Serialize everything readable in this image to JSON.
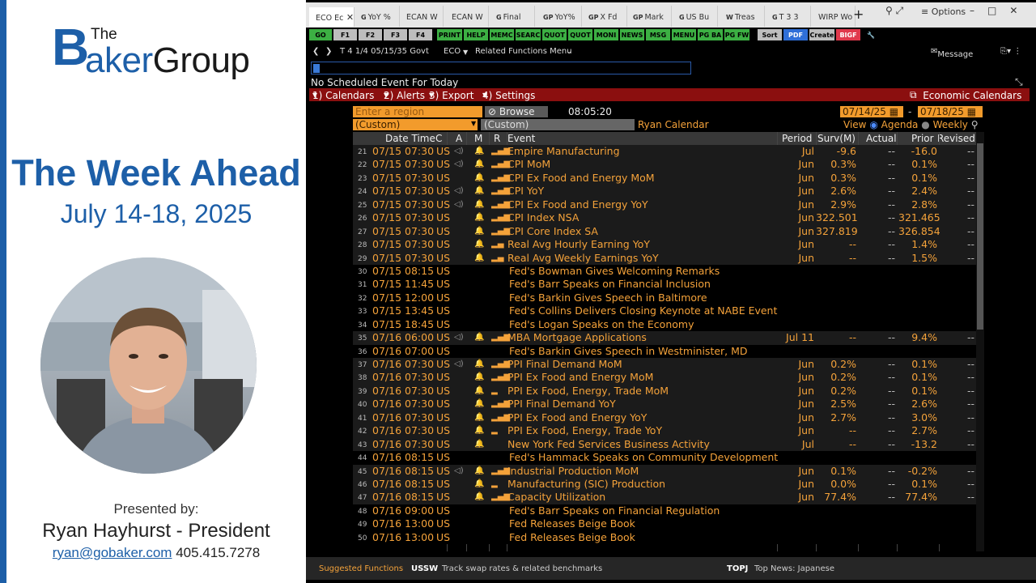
{
  "brand": {
    "the": "The",
    "b": "B",
    "aker": "aker",
    "group": "Group"
  },
  "slide": {
    "title": "The Week Ahead",
    "dates": "July 14-18, 2025",
    "presented_by": "Presented by:",
    "presenter": "Ryan Hayhurst - President",
    "email": "ryan@gobaker.com",
    "phone": "405.415.7278"
  },
  "tabs": [
    "ECO Ec",
    "YoY %",
    "ECAN W",
    "ECAN W",
    "Final",
    "YoY%",
    "X Fd",
    "Mark",
    "US Bu",
    "Treas",
    "T 3 3",
    "WIRP Wo"
  ],
  "tab_prefixes": [
    "",
    "G",
    "",
    "",
    "G",
    "GP",
    "GP",
    "GP",
    "G",
    "W",
    "G",
    ""
  ],
  "options_label": "Options",
  "fkeys": [
    {
      "label": "GO",
      "color": "#3cb043"
    },
    {
      "label": "F1",
      "color": "#bdbdbd"
    },
    {
      "label": "F2",
      "color": "#bdbdbd"
    },
    {
      "label": "F3",
      "color": "#bdbdbd"
    },
    {
      "label": "F4",
      "color": "#bdbdbd"
    },
    {
      "label": "PRINT",
      "color": "#3cb043"
    },
    {
      "label": "HELP",
      "color": "#3cb043"
    },
    {
      "label": "MEMC",
      "color": "#3cb043"
    },
    {
      "label": "SEARC",
      "color": "#3cb043"
    },
    {
      "label": "QUOT",
      "color": "#3cb043"
    },
    {
      "label": "QUOT",
      "color": "#3cb043"
    },
    {
      "label": "MONI",
      "color": "#3cb043"
    },
    {
      "label": "NEWS",
      "color": "#3cb043"
    },
    {
      "label": "MSG",
      "color": "#3cb043"
    },
    {
      "label": "MENU",
      "color": "#3cb043"
    },
    {
      "label": "PG BA",
      "color": "#3cb043"
    },
    {
      "label": "PG FW",
      "color": "#3cb043"
    },
    {
      "label": "Sort",
      "color": "#bdbdbd"
    },
    {
      "label": "PDF",
      "color": "#2f6fd8"
    },
    {
      "label": "Create",
      "color": "#bdbdbd"
    },
    {
      "label": "BIGF",
      "color": "#e0394c"
    }
  ],
  "cmdline": {
    "security": "T 4 1/4 05/15/35 Govt",
    "func": "ECO",
    "related": "Related Functions Menu",
    "message": "Message"
  },
  "no_event": "No Scheduled Event For Today",
  "menu": {
    "calendars": "1) Calendars",
    "alerts": "2) Alerts",
    "export": "3) Export",
    "settings": "4) Settings",
    "econ": "Economic Calendars"
  },
  "controls": {
    "region_placeholder": "Enter a region",
    "browse": "Browse",
    "time": "08:05:20",
    "start_date": "07/14/25",
    "end_date": "07/18/25",
    "custom1": "(Custom)",
    "custom2": "(Custom)",
    "calendar_name": "Ryan Calendar",
    "view": "View",
    "agenda": "Agenda",
    "weekly": "Weekly"
  },
  "headers": {
    "datetime": "Date Time",
    "c": "C",
    "a": "A",
    "m": "M",
    "r": "R",
    "event": "Event",
    "period": "Period",
    "surv": "Surv(M)",
    "actual": "Actual",
    "prior": "Prior",
    "revised": "Revised"
  },
  "rows": [
    {
      "n": "21",
      "dt": "07/15 07:30",
      "c": "US",
      "a": "◁)",
      "m": "🔔",
      "r": "▂▄▆",
      "e": "Empire Manufacturing",
      "p": "Jul",
      "s": "-9.6",
      "ac": "--",
      "pr": "-16.0",
      "rv": "--"
    },
    {
      "n": "22",
      "dt": "07/15 07:30",
      "c": "US",
      "a": "◁)",
      "m": "🔔",
      "r": "▂▄▆",
      "e": "CPI MoM",
      "p": "Jun",
      "s": "0.3%",
      "ac": "--",
      "pr": "0.1%",
      "rv": "--"
    },
    {
      "n": "23",
      "dt": "07/15 07:30",
      "c": "US",
      "a": "",
      "m": "🔔",
      "r": "▂▄▆",
      "e": "CPI Ex Food and Energy MoM",
      "p": "Jun",
      "s": "0.3%",
      "ac": "--",
      "pr": "0.1%",
      "rv": "--"
    },
    {
      "n": "24",
      "dt": "07/15 07:30",
      "c": "US",
      "a": "◁)",
      "m": "🔔",
      "r": "▂▄▆",
      "e": "CPI YoY",
      "p": "Jun",
      "s": "2.6%",
      "ac": "--",
      "pr": "2.4%",
      "rv": "--"
    },
    {
      "n": "25",
      "dt": "07/15 07:30",
      "c": "US",
      "a": "◁)",
      "m": "🔔",
      "r": "▂▄▆",
      "e": "CPI Ex Food and Energy YoY",
      "p": "Jun",
      "s": "2.9%",
      "ac": "--",
      "pr": "2.8%",
      "rv": "--"
    },
    {
      "n": "26",
      "dt": "07/15 07:30",
      "c": "US",
      "a": "",
      "m": "🔔",
      "r": "▂▄▆",
      "e": "CPI Index NSA",
      "p": "Jun",
      "s": "322.501",
      "ac": "--",
      "pr": "321.465",
      "rv": "--"
    },
    {
      "n": "27",
      "dt": "07/15 07:30",
      "c": "US",
      "a": "",
      "m": "🔔",
      "r": "▂▄▆",
      "e": "CPI Core Index SA",
      "p": "Jun",
      "s": "327.819",
      "ac": "--",
      "pr": "326.854",
      "rv": "--"
    },
    {
      "n": "28",
      "dt": "07/15 07:30",
      "c": "US",
      "a": "",
      "m": "🔔",
      "r": "▂▄",
      "e": "Real Avg Hourly Earning YoY",
      "p": "Jun",
      "s": "--",
      "ac": "--",
      "pr": "1.4%",
      "rv": "--"
    },
    {
      "n": "29",
      "dt": "07/15 07:30",
      "c": "US",
      "a": "",
      "m": "🔔",
      "r": "▂▄",
      "e": "Real Avg Weekly Earnings YoY",
      "p": "Jun",
      "s": "--",
      "ac": "--",
      "pr": "1.5%",
      "rv": "--"
    },
    {
      "n": "30",
      "dt": "07/15 08:15",
      "c": "US",
      "a": "",
      "m": "",
      "r": "",
      "e": "Fed's Bowman Gives Welcoming Remarks",
      "p": "",
      "s": "",
      "ac": "",
      "pr": "",
      "rv": "",
      "sp": true
    },
    {
      "n": "31",
      "dt": "07/15 11:45",
      "c": "US",
      "a": "",
      "m": "",
      "r": "",
      "e": "Fed's Barr Speaks on Financial Inclusion",
      "p": "",
      "s": "",
      "ac": "",
      "pr": "",
      "rv": "",
      "sp": true
    },
    {
      "n": "32",
      "dt": "07/15 12:00",
      "c": "US",
      "a": "",
      "m": "",
      "r": "",
      "e": "Fed's Barkin Gives Speech in Baltimore",
      "p": "",
      "s": "",
      "ac": "",
      "pr": "",
      "rv": "",
      "sp": true
    },
    {
      "n": "33",
      "dt": "07/15 13:45",
      "c": "US",
      "a": "",
      "m": "",
      "r": "",
      "e": "Fed's Collins Delivers Closing Keynote at NABE Event",
      "p": "",
      "s": "",
      "ac": "",
      "pr": "",
      "rv": "",
      "sp": true
    },
    {
      "n": "34",
      "dt": "07/15 18:45",
      "c": "US",
      "a": "",
      "m": "",
      "r": "",
      "e": "Fed's Logan Speaks on the Economy",
      "p": "",
      "s": "",
      "ac": "",
      "pr": "",
      "rv": "",
      "sp": true
    },
    {
      "n": "35",
      "dt": "07/16 06:00",
      "c": "US",
      "a": "◁)",
      "m": "🔔",
      "r": "▂▄▆",
      "e": "MBA Mortgage Applications",
      "p": "Jul 11",
      "s": "--",
      "ac": "--",
      "pr": "9.4%",
      "rv": "--"
    },
    {
      "n": "36",
      "dt": "07/16 07:00",
      "c": "US",
      "a": "",
      "m": "",
      "r": "",
      "e": "Fed's Barkin Gives Speech in Westminister, MD",
      "p": "",
      "s": "",
      "ac": "",
      "pr": "",
      "rv": "",
      "sp": true
    },
    {
      "n": "37",
      "dt": "07/16 07:30",
      "c": "US",
      "a": "◁)",
      "m": "🔔",
      "r": "▂▄▆",
      "e": "PPI Final Demand MoM",
      "p": "Jun",
      "s": "0.2%",
      "ac": "--",
      "pr": "0.1%",
      "rv": "--"
    },
    {
      "n": "38",
      "dt": "07/16 07:30",
      "c": "US",
      "a": "",
      "m": "🔔",
      "r": "▂▄▆",
      "e": "PPI Ex Food and Energy MoM",
      "p": "Jun",
      "s": "0.2%",
      "ac": "--",
      "pr": "0.1%",
      "rv": "--"
    },
    {
      "n": "39",
      "dt": "07/16 07:30",
      "c": "US",
      "a": "",
      "m": "🔔",
      "r": "▂",
      "e": "PPI Ex Food, Energy, Trade MoM",
      "p": "Jun",
      "s": "0.2%",
      "ac": "--",
      "pr": "0.1%",
      "rv": "--"
    },
    {
      "n": "40",
      "dt": "07/16 07:30",
      "c": "US",
      "a": "",
      "m": "🔔",
      "r": "▂▄▆",
      "e": "PPI Final Demand YoY",
      "p": "Jun",
      "s": "2.5%",
      "ac": "--",
      "pr": "2.6%",
      "rv": "--"
    },
    {
      "n": "41",
      "dt": "07/16 07:30",
      "c": "US",
      "a": "",
      "m": "🔔",
      "r": "▂▄▆",
      "e": "PPI Ex Food and Energy YoY",
      "p": "Jun",
      "s": "2.7%",
      "ac": "--",
      "pr": "3.0%",
      "rv": "--"
    },
    {
      "n": "42",
      "dt": "07/16 07:30",
      "c": "US",
      "a": "",
      "m": "🔔",
      "r": "▂",
      "e": "PPI Ex Food, Energy, Trade YoY",
      "p": "Jun",
      "s": "--",
      "ac": "--",
      "pr": "2.7%",
      "rv": "--"
    },
    {
      "n": "43",
      "dt": "07/16 07:30",
      "c": "US",
      "a": "",
      "m": "🔔",
      "r": "",
      "e": "New York Fed Services Business Activity",
      "p": "Jul",
      "s": "--",
      "ac": "--",
      "pr": "-13.2",
      "rv": "--"
    },
    {
      "n": "44",
      "dt": "07/16 08:15",
      "c": "US",
      "a": "",
      "m": "",
      "r": "",
      "e": "Fed's Hammack Speaks on Community Development",
      "p": "",
      "s": "",
      "ac": "",
      "pr": "",
      "rv": "",
      "sp": true
    },
    {
      "n": "45",
      "dt": "07/16 08:15",
      "c": "US",
      "a": "◁)",
      "m": "🔔",
      "r": "▂▄▆",
      "e": "Industrial Production MoM",
      "p": "Jun",
      "s": "0.1%",
      "ac": "--",
      "pr": "-0.2%",
      "rv": "--"
    },
    {
      "n": "46",
      "dt": "07/16 08:15",
      "c": "US",
      "a": "",
      "m": "🔔",
      "r": "▂",
      "e": "Manufacturing (SIC) Production",
      "p": "Jun",
      "s": "0.0%",
      "ac": "--",
      "pr": "0.1%",
      "rv": "--"
    },
    {
      "n": "47",
      "dt": "07/16 08:15",
      "c": "US",
      "a": "",
      "m": "🔔",
      "r": "▂▄▆",
      "e": "Capacity Utilization",
      "p": "Jun",
      "s": "77.4%",
      "ac": "--",
      "pr": "77.4%",
      "rv": "--"
    },
    {
      "n": "48",
      "dt": "07/16 09:00",
      "c": "US",
      "a": "",
      "m": "",
      "r": "",
      "e": "Fed's Barr Speaks on Financial Regulation",
      "p": "",
      "s": "",
      "ac": "",
      "pr": "",
      "rv": "",
      "sp": true
    },
    {
      "n": "49",
      "dt": "07/16 13:00",
      "c": "US",
      "a": "",
      "m": "",
      "r": "",
      "e": "Fed Releases Beige Book",
      "p": "",
      "s": "",
      "ac": "",
      "pr": "",
      "rv": "",
      "sp": true
    },
    {
      "n": "50",
      "dt": "07/16 13:00",
      "c": "US",
      "a": "",
      "m": "",
      "r": "",
      "e": "Fed Releases Beige Book",
      "p": "",
      "s": "",
      "ac": "",
      "pr": "",
      "rv": "",
      "sp": true
    }
  ],
  "bottom": {
    "suggested": "Suggested Functions",
    "usss_code": "USSW",
    "usss_desc": "Track swap rates & related benchmarks",
    "topj_code": "TOPJ",
    "topj_desc": "Top News: Japanese"
  }
}
